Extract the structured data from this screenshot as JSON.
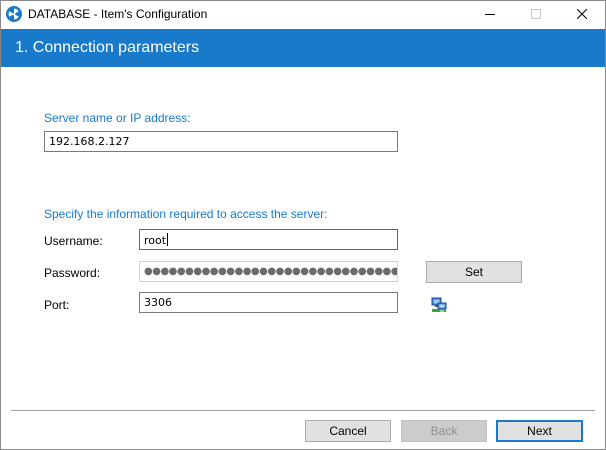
{
  "window": {
    "title": "DATABASE - Item's Configuration",
    "controls": {
      "minimize": "minimize-icon",
      "maximize": "maximize-icon",
      "close": "close-icon"
    }
  },
  "header": {
    "title": "1. Connection parameters"
  },
  "server": {
    "label": "Server name or IP address:",
    "value": "192.168.2.127"
  },
  "access": {
    "label": "Specify the information required to access the server:",
    "username_label": "Username:",
    "username_value": "root",
    "password_label": "Password:",
    "password_value": "●●●●●●●●●●●●●●●●●●●●●●●●●●●●●●●●●●●●●●●●",
    "set_label": "Set",
    "port_label": "Port:",
    "port_value": "3306",
    "test_icon": "network-connect-icon"
  },
  "footer": {
    "cancel_label": "Cancel",
    "back_label": "Back",
    "next_label": "Next"
  },
  "colors": {
    "accent": "#1979ca",
    "disabled_text": "#8d8d8d"
  }
}
